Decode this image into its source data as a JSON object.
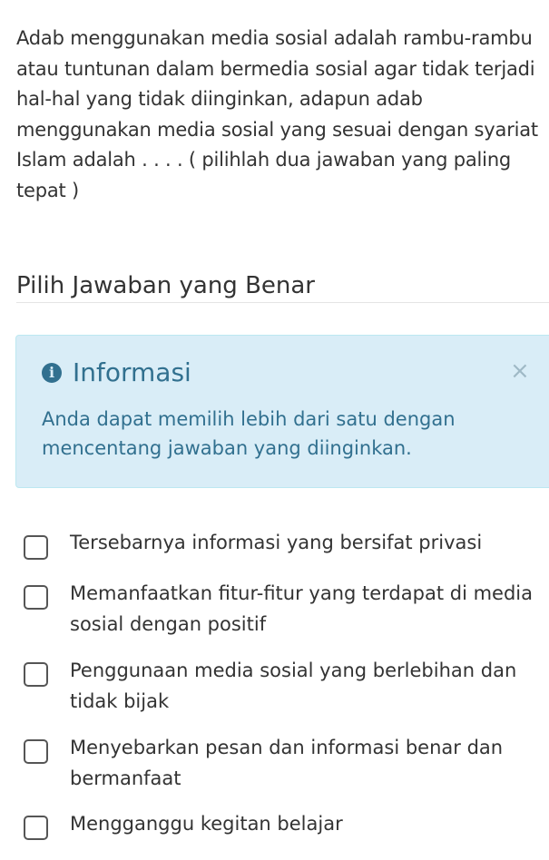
{
  "question": {
    "text": "Adab menggunakan media sosial adalah rambu-rambu atau tuntunan dalam bermedia sosial agar tidak terjadi hal-hal yang tidak diinginkan, adapun adab menggunakan media sosial  yang sesuai dengan syariat Islam adalah . . . . ( pilihlah dua jawaban yang paling tepat )"
  },
  "answers_section": {
    "title": "Pilih Jawaban yang Benar"
  },
  "info_alert": {
    "icon": "info-circle-icon",
    "heading": "Informasi",
    "close_symbol": "×",
    "body": "Anda dapat memilih lebih dari satu dengan mencentang jawaban yang diinginkan.",
    "colors": {
      "background": "#d9edf7",
      "border": "#bce8f1",
      "text": "#31708f"
    }
  },
  "options": [
    {
      "label": "Tersebarnya informasi yang bersifat privasi",
      "checked": false
    },
    {
      "label": "Memanfaatkan fitur-fitur yang terdapat di media sosial dengan positif",
      "checked": false
    },
    {
      "label": "Penggunaan media sosial yang berlebihan dan tidak bijak",
      "checked": false
    },
    {
      "label": "Menyebarkan pesan dan informasi benar dan bermanfaat",
      "checked": false
    },
    {
      "label": "Mengganggu kegitan belajar",
      "checked": false
    }
  ]
}
